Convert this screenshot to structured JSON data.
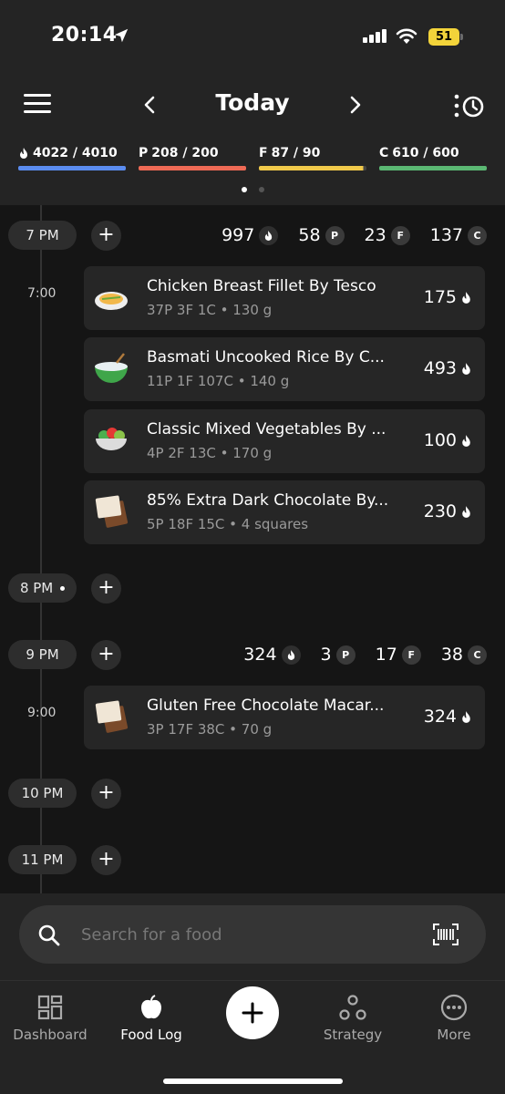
{
  "status": {
    "time": "20:14",
    "battery": "51"
  },
  "header": {
    "title": "Today"
  },
  "macros": [
    {
      "label": "4022 / 4010",
      "prefix": "",
      "color": "#5b8cef",
      "fill": 1.0
    },
    {
      "label": "208 / 200",
      "prefix": "P",
      "color": "#ee6a55",
      "fill": 1.0
    },
    {
      "label": "87 / 90",
      "prefix": "F",
      "color": "#f0c94a",
      "fill": 0.97
    },
    {
      "label": "610 / 600",
      "prefix": "C",
      "color": "#5bb873",
      "fill": 1.0
    }
  ],
  "timeline": {
    "hours": [
      {
        "label": "7 PM",
        "calories": "997",
        "protein": "58",
        "fat": "23",
        "carbs": "137"
      },
      {
        "label": "8 PM"
      },
      {
        "label": "9 PM",
        "calories": "324",
        "protein": "3",
        "fat": "17",
        "carbs": "38"
      },
      {
        "label": "10 PM"
      },
      {
        "label": "11 PM"
      }
    ],
    "stat_letters": {
      "protein": "P",
      "fat": "F",
      "carbs": "C"
    },
    "entry_times": [
      "7:00",
      "9:00"
    ],
    "foods": [
      {
        "name": "Chicken Breast Fillet By Tesco",
        "meta": "37P   3F   1C  •  130 g",
        "calories": "175",
        "icon": "plate-icon"
      },
      {
        "name": "Basmati Uncooked Rice By C...",
        "meta": "11P   1F   107C  •  140 g",
        "calories": "493",
        "icon": "bowl-icon"
      },
      {
        "name": "Classic Mixed Vegetables By ...",
        "meta": "4P   2F   13C  •  170 g",
        "calories": "100",
        "icon": "salad-icon"
      },
      {
        "name": "85% Extra Dark Chocolate By...",
        "meta": "5P   18F   15C  •  4 squares",
        "calories": "230",
        "icon": "chocolate-icon"
      },
      {
        "name": "Gluten Free Chocolate Macar...",
        "meta": "3P   17F   38C  •  70 g",
        "calories": "324",
        "icon": "chocolate-icon"
      }
    ]
  },
  "search": {
    "placeholder": "Search for a food"
  },
  "tabs": [
    {
      "label": "Dashboard",
      "icon": "dashboard-icon"
    },
    {
      "label": "Food Log",
      "icon": "apple-icon"
    },
    {
      "label": "Strategy",
      "icon": "strategy-icon"
    },
    {
      "label": "More",
      "icon": "more-icon"
    }
  ],
  "colors": {
    "background": "#151515",
    "panel": "#242424",
    "card": "#262626"
  }
}
